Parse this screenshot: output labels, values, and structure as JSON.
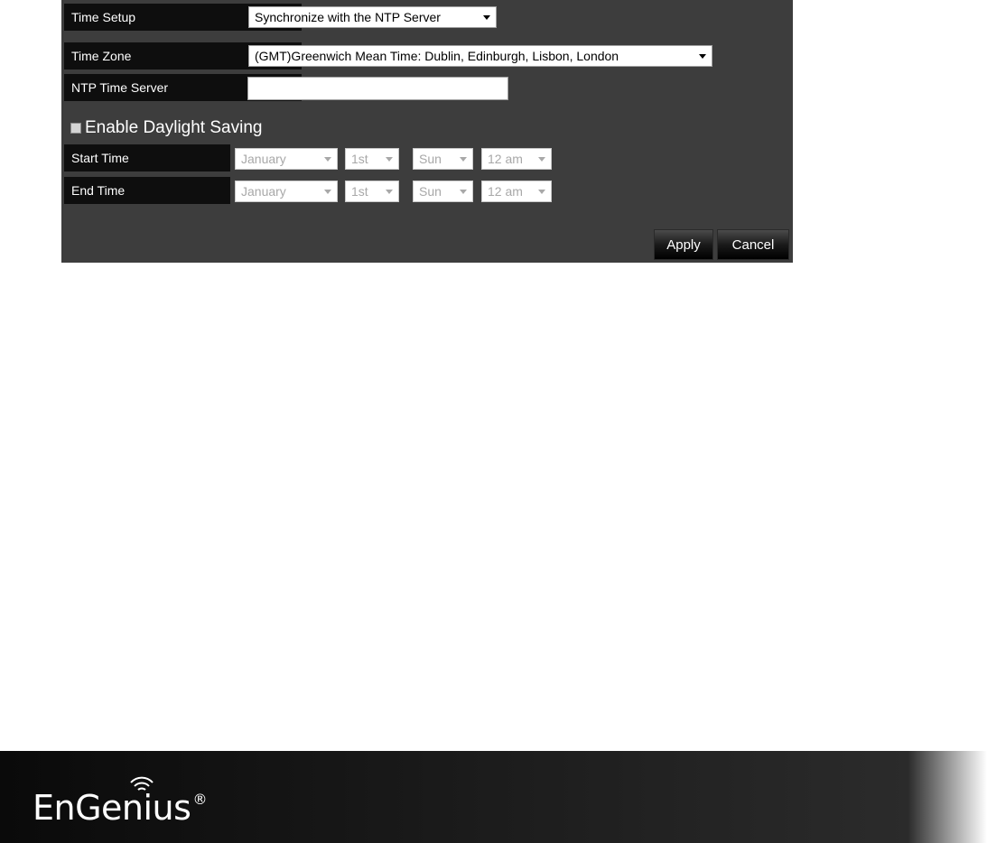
{
  "time_setup": {
    "label": "Time Setup",
    "value": "Synchronize with the NTP Server"
  },
  "time_zone": {
    "label": "Time Zone",
    "value": "(GMT)Greenwich Mean Time: Dublin, Edinburgh, Lisbon, London"
  },
  "ntp_server": {
    "label": "NTP Time Server",
    "value": ""
  },
  "daylight_saving": {
    "label": "Enable Daylight Saving",
    "checked": false
  },
  "start_time": {
    "label": "Start Time",
    "month": "January",
    "week": "1st",
    "day": "Sun",
    "hour": "12 am"
  },
  "end_time": {
    "label": "End Time",
    "month": "January",
    "week": "1st",
    "day": "Sun",
    "hour": "12 am"
  },
  "buttons": {
    "apply": "Apply",
    "cancel": "Cancel"
  },
  "footer": {
    "logo": "EnGenius",
    "logo_mark": "®"
  },
  "colors": {
    "panel_bg": "#3d3d3d",
    "label_bg": "#0e0e0e",
    "text": "#ffffff"
  }
}
